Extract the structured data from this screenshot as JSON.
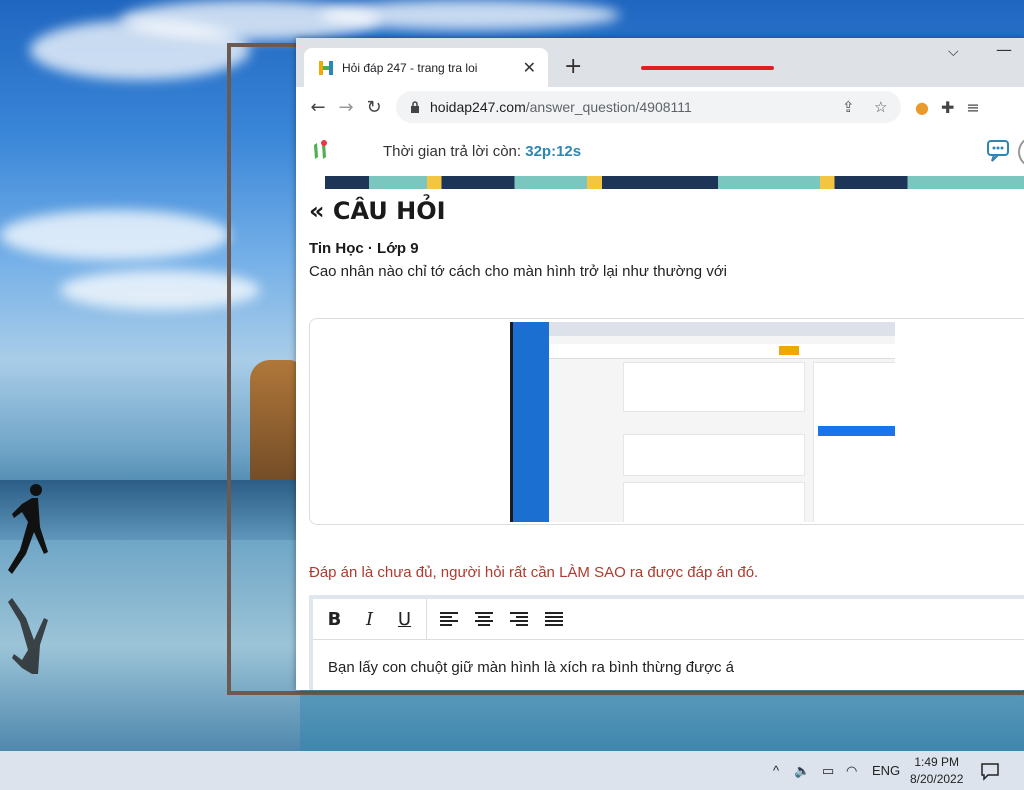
{
  "browser": {
    "tab_title": "Hỏi đáp 247 - trang tra loi",
    "tab_close": "✕",
    "new_tab": "+",
    "url_domain": "hoidap247.com",
    "url_path": "/answer_question/4908111",
    "chevron": "⌵",
    "minimize": "—"
  },
  "header": {
    "timer_label": "Thời gian trả lời còn: ",
    "timer_value": "32p:12s"
  },
  "question": {
    "heading": "« CÂU HỎI",
    "subject": "Tin Học · Lớp 9",
    "text": "Cao nhân nào chỉ tớ cách cho màn hình trở lại như thường với"
  },
  "notice": "Đáp án là chưa đủ, người hỏi rất cần LÀM SAO ra được đáp án đó.",
  "editor": {
    "bold": "B",
    "italic": "I",
    "underline": "U",
    "content": "Bạn lấy con chuột giữ màn hình là xích ra bình thừng được á"
  },
  "taskbar": {
    "caret": "^",
    "language": "ENG",
    "time": "1:49 PM",
    "date": "8/20/2022"
  },
  "colors": {
    "accent": "#2e86b3",
    "notice": "#b03a2e",
    "tab_red_line": "#e02020"
  }
}
